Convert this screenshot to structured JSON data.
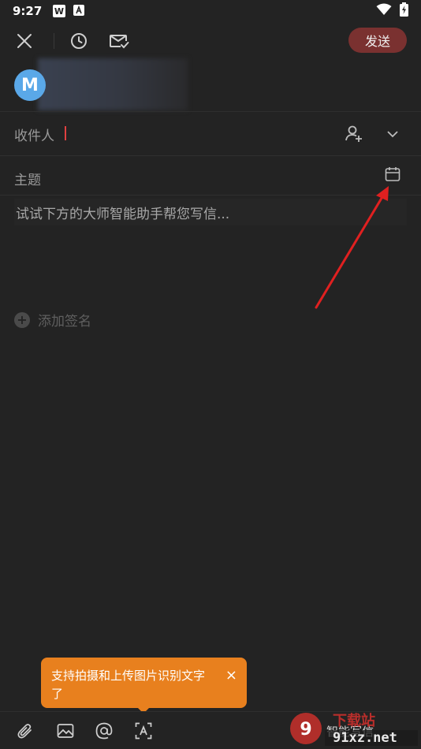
{
  "status_bar": {
    "time": "9:27",
    "icons": [
      "wps-icon",
      "app-a-icon",
      "wifi-icon",
      "battery-charging-icon"
    ]
  },
  "toolbar": {
    "close_icon": "close-icon",
    "schedule_icon": "clock-icon",
    "receipt_icon": "mail-check-icon",
    "send_label": "发送"
  },
  "sender": {
    "avatar_letter": "M"
  },
  "fields": {
    "recipient_label": "收件人",
    "subject_label": "主题"
  },
  "body": {
    "placeholder": "试试下方的大师智能助手帮您写信..."
  },
  "signature": {
    "label": "添加签名"
  },
  "tooltip": {
    "text": "支持拍摄和上传图片识别文字了",
    "close": "×"
  },
  "bottom_bar": {
    "smart_write": "智能写信",
    "icons": [
      "attachment-icon",
      "image-icon",
      "mention-icon",
      "text-recognition-icon"
    ]
  },
  "watermark": {
    "text": "91xz.net"
  },
  "colors": {
    "background": "#232323",
    "send_button": "#7a3130",
    "tooltip": "#e8801e",
    "avatar": "#5aa8e8",
    "arrow": "#e02020"
  }
}
